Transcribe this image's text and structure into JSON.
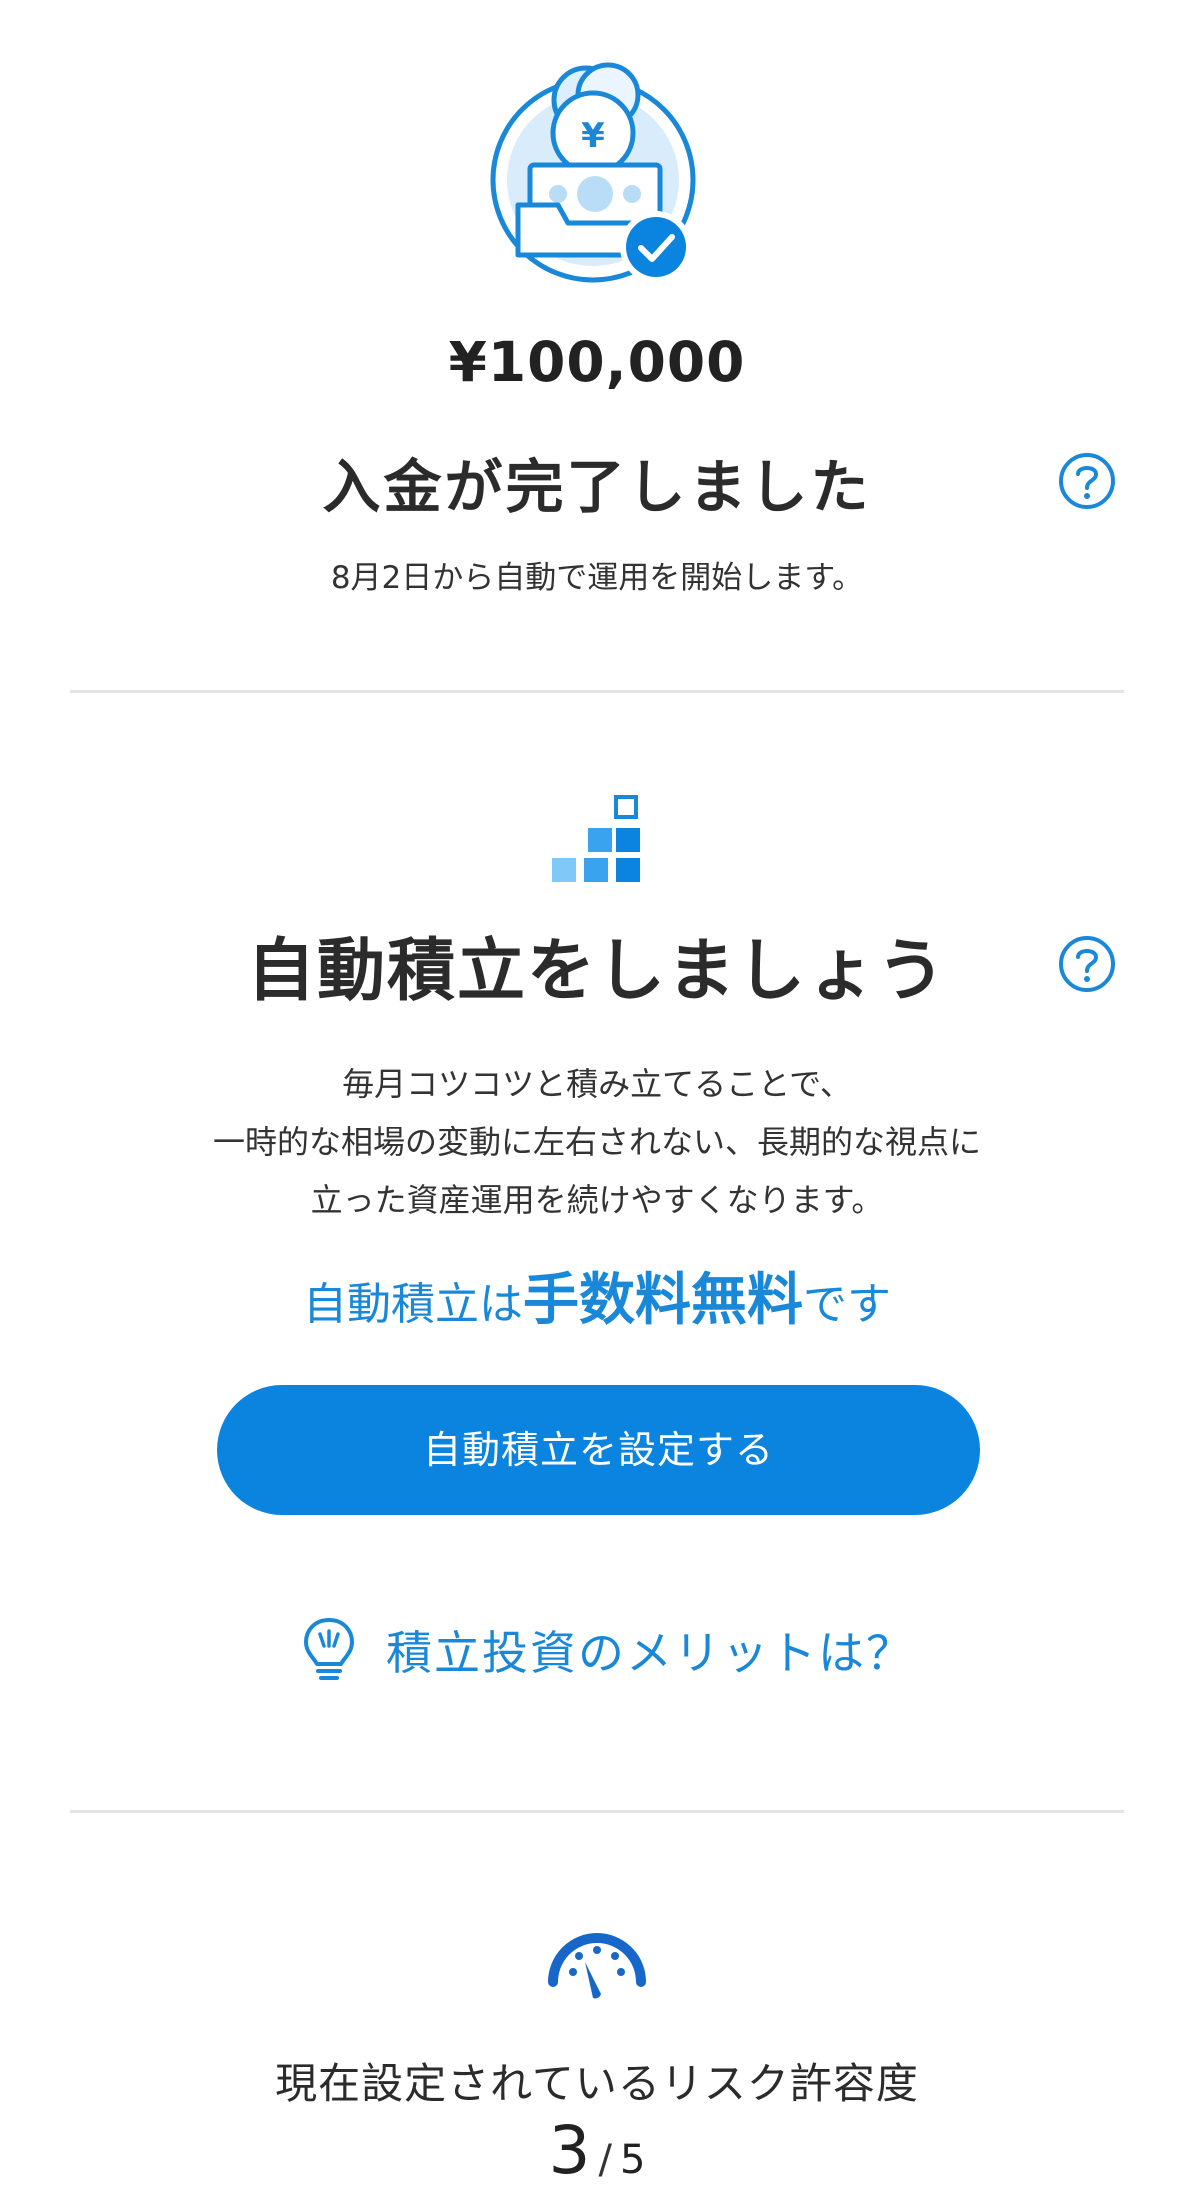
{
  "deposit": {
    "amount": "¥100,000",
    "title": "入金が完了しました",
    "subtitle": "8月2日から自動で運用を開始します。"
  },
  "auto_saving": {
    "title": "自動積立をしましょう",
    "description": [
      "毎月コツコツと積み立てることで、",
      "一時的な相場の変動に左右されない、長期的な視点に",
      "立った資産運用を続けやすくなります。"
    ],
    "fee_prefix": "自動積立は",
    "fee_bold": "手数料無料",
    "fee_suffix": "です",
    "button_label": "自動積立を設定する",
    "merit_link": "積立投資のメリットは？"
  },
  "risk": {
    "title": "現在設定されているリスク許容度",
    "current": "3",
    "max": "5"
  },
  "icons": {
    "deposit": "deposit-complete-icon",
    "help": "question-circle-icon",
    "blocks": "stacking-blocks-icon",
    "bulb": "lightbulb-icon",
    "gauge": "risk-gauge-icon"
  },
  "colors": {
    "accent": "#0b84e0",
    "link": "#1a88d8",
    "light_blue": "#5db8f5",
    "divider": "#e4e4e4"
  }
}
